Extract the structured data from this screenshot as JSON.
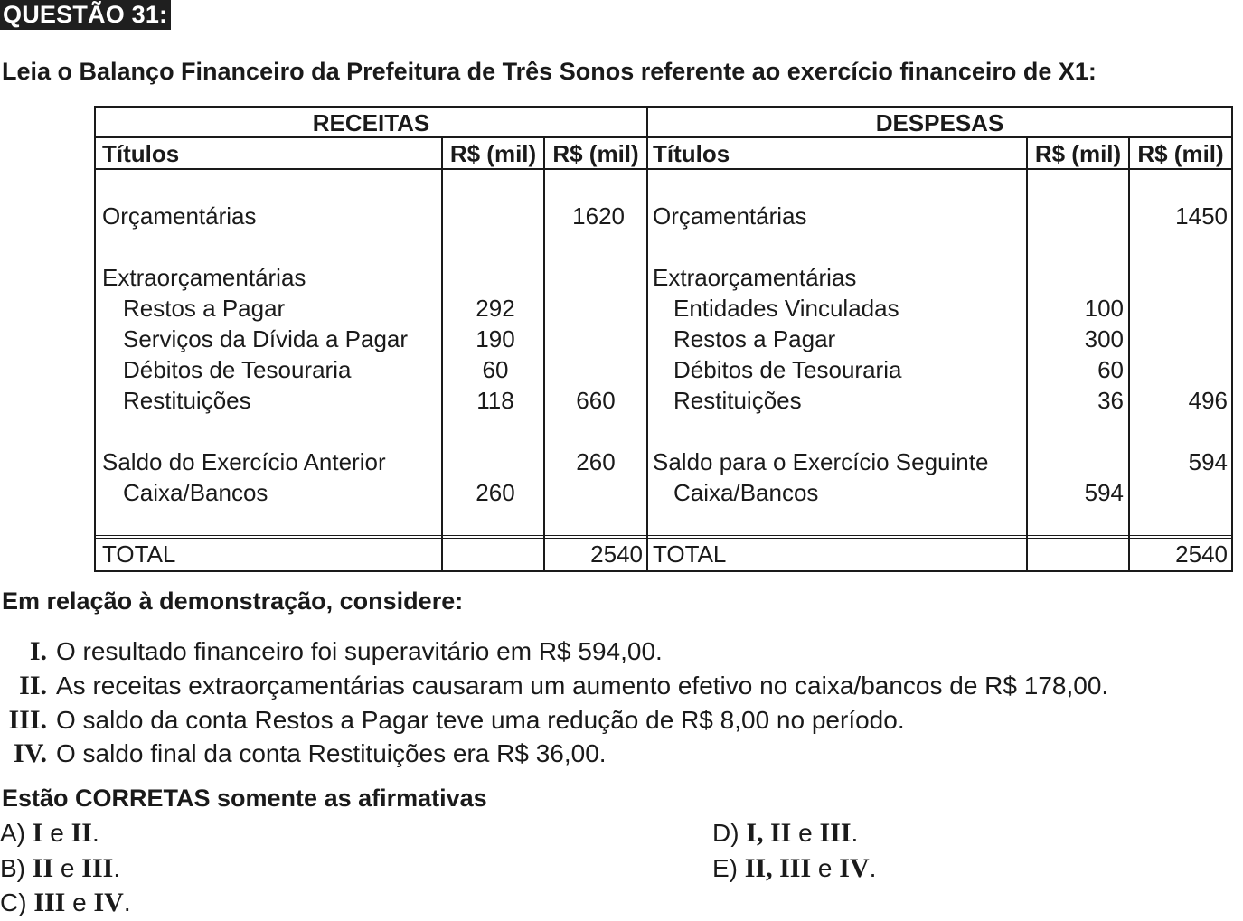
{
  "header": {
    "question_label": "QUESTÃO 31:",
    "intro": "Leia o Balanço Financeiro da Prefeitura de Três Sonos referente ao exercício financeiro de X1:"
  },
  "table": {
    "receitas_title": "RECEITAS",
    "despesas_title": "DESPESAS",
    "col_titulos": "Títulos",
    "col_rs": "R$ (mil)",
    "left": {
      "orc_label": "Orçamentárias",
      "orc_total": "1620",
      "extra_label": "Extraorçamentárias",
      "extra_items": [
        {
          "label": "Restos a Pagar",
          "value": "292"
        },
        {
          "label": "Serviços da Dívida a Pagar",
          "value": "190"
        },
        {
          "label": "Débitos de Tesouraria",
          "value": "60"
        },
        {
          "label": "Restituições",
          "value": "118"
        }
      ],
      "extra_total": "660",
      "saldo_label": "Saldo do Exercício Anterior",
      "saldo_total": "260",
      "caixa_label": "Caixa/Bancos",
      "caixa_value": "260",
      "total_label": "TOTAL",
      "total_value": "2540"
    },
    "right": {
      "orc_label": "Orçamentárias",
      "orc_total": "1450",
      "extra_label": "Extraorçamentárias",
      "extra_items": [
        {
          "label": "Entidades Vinculadas",
          "value": "100"
        },
        {
          "label": "Restos a Pagar",
          "value": "300"
        },
        {
          "label": "Débitos de Tesouraria",
          "value": "60"
        },
        {
          "label": "Restituições",
          "value": "36"
        }
      ],
      "extra_total": "496",
      "saldo_label": "Saldo para o Exercício Seguinte",
      "saldo_total": "594",
      "caixa_label": "Caixa/Bancos",
      "caixa_value": "594",
      "total_label": "TOTAL",
      "total_value": "2540"
    }
  },
  "consider_heading": "Em relação à demonstração, considere:",
  "statements": [
    {
      "roman": "I.",
      "text": "O resultado financeiro foi superavitário em R$ 594,00."
    },
    {
      "roman": "II.",
      "text": "As receitas extraorçamentárias causaram um aumento efetivo no caixa/bancos de R$ 178,00."
    },
    {
      "roman": "III.",
      "text": "O saldo da conta Restos a Pagar teve uma redução de R$ 8,00 no período."
    },
    {
      "roman": "IV.",
      "text": "O saldo final da conta Restituições era R$ 36,00."
    }
  ],
  "correct_heading": "Estão CORRETAS somente as afirmativas",
  "options": {
    "a": {
      "letter": "A)",
      "p1": "I",
      "sep1": " e ",
      "p2": "II",
      "end": "."
    },
    "b": {
      "letter": "B)",
      "p1": "II",
      "sep1": " e ",
      "p2": "III",
      "end": "."
    },
    "c": {
      "letter": "C)",
      "p1": "III",
      "sep1": " e ",
      "p2": "IV",
      "end": "."
    },
    "d": {
      "letter": "D)",
      "p1": "I, II",
      "sep1": " e ",
      "p2": "III",
      "end": "."
    },
    "e": {
      "letter": "E)",
      "p1": "II, III",
      "sep1": " e ",
      "p2": "IV",
      "end": "."
    }
  }
}
